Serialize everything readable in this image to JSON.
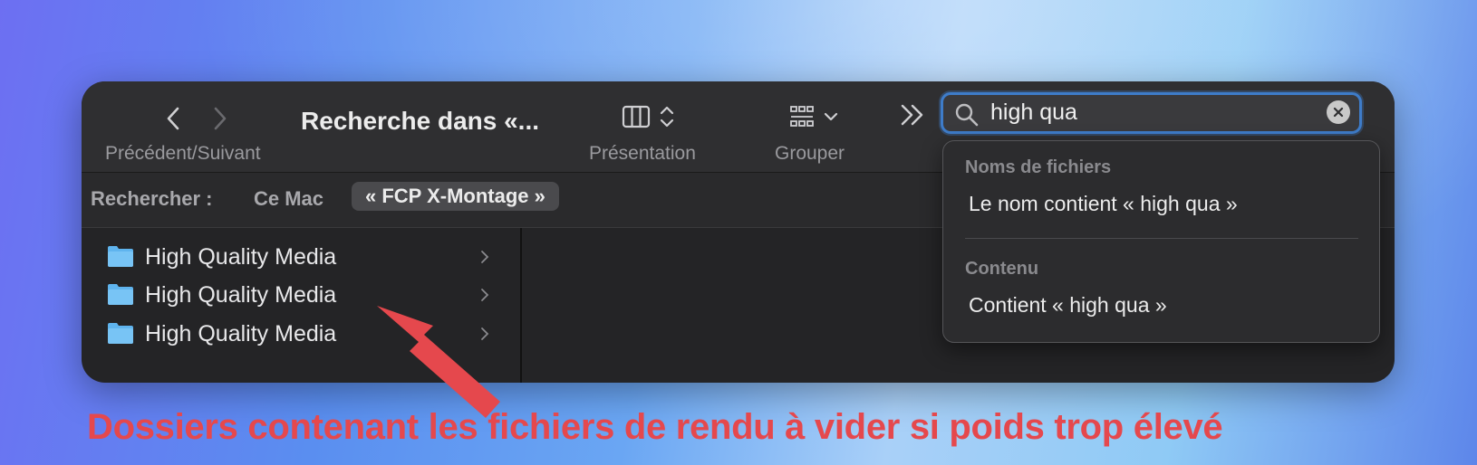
{
  "toolbar": {
    "nav_label": "Précédent/Suivant",
    "title": "Recherche dans «...",
    "presentation_label": "Présentation",
    "group_label": "Grouper"
  },
  "search": {
    "value": "high qua"
  },
  "scope": {
    "label": "Rechercher :",
    "mac": "Ce Mac",
    "folder": "« FCP X-Montage »"
  },
  "results": [
    {
      "name": "High Quality Media"
    },
    {
      "name": "High Quality Media"
    },
    {
      "name": "High Quality Media"
    }
  ],
  "dropdown": {
    "filenames_header": "Noms de fichiers",
    "filenames_item": "Le nom contient « high qua »",
    "content_header": "Contenu",
    "content_item": "Contient « high qua »"
  },
  "annotation": "Dossiers contenant les fichiers de rendu à vider si poids trop élevé",
  "colors": {
    "accent": "#3e7cc9",
    "annotation": "#e5484d",
    "folder": "#5fb4ee"
  }
}
